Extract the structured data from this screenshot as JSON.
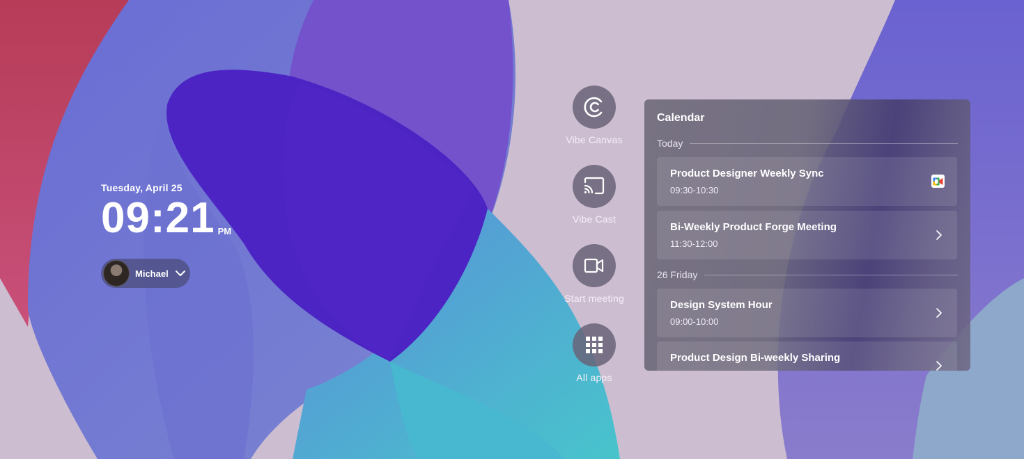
{
  "clock": {
    "date": "Tuesday, April 25",
    "time": "09:21",
    "period": "PM"
  },
  "user": {
    "name": "Michael"
  },
  "actions": [
    {
      "label": "Vibe Canvas",
      "icon": "vibe-canvas-icon"
    },
    {
      "label": "Vibe Cast",
      "icon": "cast-icon"
    },
    {
      "label": "Start meeting",
      "icon": "video-camera-icon"
    },
    {
      "label": "All apps",
      "icon": "grid-icon"
    }
  ],
  "calendar": {
    "title": "Calendar",
    "days": [
      {
        "label": "Today",
        "events": [
          {
            "title": "Product Designer Weekly Sync",
            "time": "09:30-10:30",
            "icon": "google-meet-icon"
          },
          {
            "title": "Bi-Weekly Product Forge Meeting",
            "time": "11:30-12:00",
            "icon": "chevron-right-icon"
          }
        ]
      },
      {
        "label": "26 Friday",
        "events": [
          {
            "title": "Design System Hour",
            "time": "09:00-10:00",
            "icon": "chevron-right-icon"
          },
          {
            "title": "Product Design Bi-weekly Sharing",
            "time": "",
            "icon": "chevron-right-icon"
          }
        ]
      }
    ]
  },
  "colors": {
    "red_wave": "#c03c5c",
    "blue_wave": "#6668d0",
    "indigo": "#4c24c4",
    "cyan": "#4abccc",
    "lilac_bg": "#cdbdd0"
  }
}
